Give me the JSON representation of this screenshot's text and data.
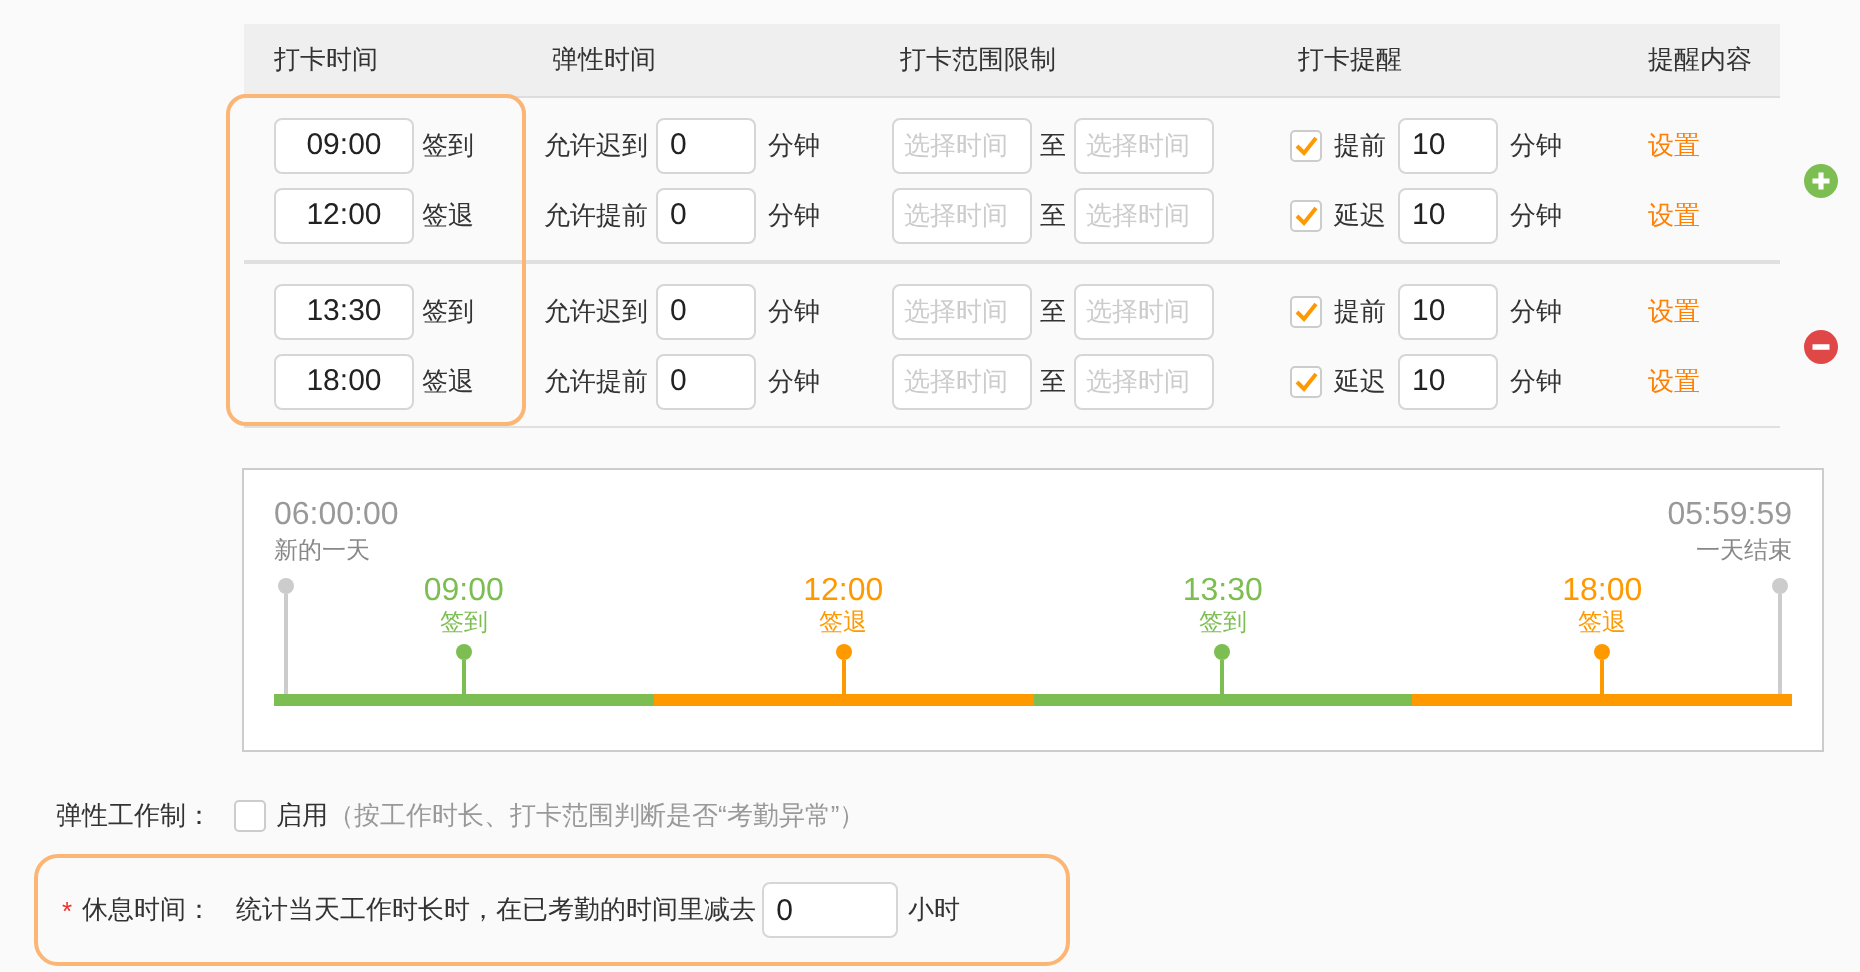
{
  "table": {
    "columns": [
      {
        "label": "打卡时间",
        "highlighted": true
      },
      {
        "label": "弹性时间"
      },
      {
        "label": "打卡范围限制"
      },
      {
        "label": "打卡提醒"
      },
      {
        "label": "提醒内容"
      }
    ],
    "groups": [
      {
        "kind": "add",
        "rows": [
          {
            "time": "09:00",
            "punch": "签到",
            "flex_label": "允许迟到",
            "flex_value": "0",
            "flex_unit": "分钟",
            "range_from_placeholder": "选择时间",
            "range_sep": "至",
            "range_to_placeholder": "选择时间",
            "remind_checked": true,
            "remind_label": "提前",
            "remind_value": "10",
            "remind_unit": "分钟",
            "content_link": "设置"
          },
          {
            "time": "12:00",
            "punch": "签退",
            "flex_label": "允许提前",
            "flex_value": "0",
            "flex_unit": "分钟",
            "range_from_placeholder": "选择时间",
            "range_sep": "至",
            "range_to_placeholder": "选择时间",
            "remind_checked": true,
            "remind_label": "延迟",
            "remind_value": "10",
            "remind_unit": "分钟",
            "content_link": "设置"
          }
        ]
      },
      {
        "kind": "remove",
        "rows": [
          {
            "time": "13:30",
            "punch": "签到",
            "flex_label": "允许迟到",
            "flex_value": "0",
            "flex_unit": "分钟",
            "range_from_placeholder": "选择时间",
            "range_sep": "至",
            "range_to_placeholder": "选择时间",
            "remind_checked": true,
            "remind_label": "提前",
            "remind_value": "10",
            "remind_unit": "分钟",
            "content_link": "设置"
          },
          {
            "time": "18:00",
            "punch": "签退",
            "flex_label": "允许提前",
            "flex_value": "0",
            "flex_unit": "分钟",
            "range_from_placeholder": "选择时间",
            "range_sep": "至",
            "range_to_placeholder": "选择时间",
            "remind_checked": true,
            "remind_label": "延迟",
            "remind_value": "10",
            "remind_unit": "分钟",
            "content_link": "设置"
          }
        ]
      }
    ]
  },
  "timeline": {
    "start": {
      "time": "06:00:00",
      "label": "新的一天"
    },
    "end": {
      "time": "05:59:59",
      "label": "一天结束"
    },
    "events": [
      {
        "time": "09:00",
        "label": "签到",
        "kind": "in"
      },
      {
        "time": "12:00",
        "label": "签退",
        "kind": "out"
      },
      {
        "time": "13:30",
        "label": "签到",
        "kind": "in"
      },
      {
        "time": "18:00",
        "label": "签退",
        "kind": "out"
      }
    ]
  },
  "flex_work": {
    "label": "弹性工作制：",
    "checked": false,
    "option": "启用",
    "hint": "（按工作时长、打卡范围判断是否“考勤异常”）"
  },
  "rest": {
    "highlighted": true,
    "required_mark": "*",
    "label": "休息时间：",
    "text": "统计当天工作时长时，在已考勤的时间里减去",
    "value": "0",
    "unit": "小时"
  }
}
